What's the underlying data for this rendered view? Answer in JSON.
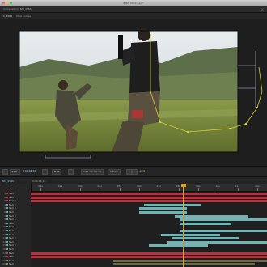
{
  "window": {
    "title": "BMW 5000.aep *",
    "lights": [
      "#ff5f56",
      "#ffbd2e",
      "#27c93f"
    ]
  },
  "composition_panel": {
    "title": "Composition: NM_4586",
    "close_glyph": "×",
    "tabs": [
      "1_4586",
      "Shot Comps"
    ]
  },
  "viewer": {
    "description_icon": "video-frame",
    "bezier_color": "#d8d030",
    "guide_color": "#bcd2e6"
  },
  "comp_toolbar": {
    "zoom": "50%",
    "timecode": "0;00;06;10",
    "resolution": "Half",
    "view": "Active Camera",
    "views": "1 View",
    "exposure": "+0.0"
  },
  "timeline": {
    "header_left": "NM_4586",
    "header_time": "0;00;06;10",
    "ticks": [
      "01s",
      "02s",
      "03s",
      "04s",
      "05s",
      "06s",
      "07s",
      "08s",
      "09s",
      "10s",
      "11s",
      "12s"
    ],
    "layers": [
      {
        "n": "1",
        "name": "Null",
        "color": "#c43d3d"
      },
      {
        "n": "2",
        "name": "Null",
        "color": "#c43d3d"
      },
      {
        "n": "3",
        "name": "Null 9",
        "color": "#c43d3d"
      },
      {
        "n": "4",
        "name": "Null 2",
        "color": "#5fa8a8"
      },
      {
        "n": "5",
        "name": "Null 3",
        "color": "#5fa8a8"
      },
      {
        "n": "6",
        "name": "Null",
        "color": "#5fa8a8"
      },
      {
        "n": "7",
        "name": "Null 4",
        "color": "#5fa8a8"
      },
      {
        "n": "8",
        "name": "Null 5",
        "color": "#5fa8a8"
      },
      {
        "n": "9",
        "name": "Null",
        "color": "#5fa8a8"
      },
      {
        "n": "10",
        "name": "Null 6",
        "color": "#5fa8a8"
      },
      {
        "n": "11",
        "name": "Null",
        "color": "#5fa8a8"
      },
      {
        "n": "12",
        "name": "Null 7",
        "color": "#5fa8a8"
      },
      {
        "n": "13",
        "name": "Null 8",
        "color": "#5fa8a8"
      },
      {
        "n": "14",
        "name": "Null",
        "color": "#5fa8a8"
      },
      {
        "n": "15",
        "name": "Null 9",
        "color": "#5fa8a8"
      },
      {
        "n": "16",
        "name": "Null",
        "color": "#5fa8a8"
      },
      {
        "n": "17",
        "name": "Null",
        "color": "#c43d3d"
      },
      {
        "n": "18",
        "name": "Null",
        "color": "#c43d3d"
      },
      {
        "n": "19",
        "name": "Null",
        "color": "#8a8a5a"
      },
      {
        "n": "20",
        "name": "Null",
        "color": "#8a8a5a"
      }
    ],
    "bars": [
      {
        "start": 0.0,
        "end": 1.0,
        "color": "#b8323e"
      },
      {
        "start": 0.0,
        "end": 1.0,
        "color": "#b8323e"
      },
      {
        "start": 0.0,
        "end": 1.0,
        "color": "#b8323e"
      },
      {
        "start": 0.48,
        "end": 0.72,
        "color": "#6fb4b4"
      },
      {
        "start": 0.46,
        "end": 0.66,
        "color": "#6fb4b4"
      },
      {
        "start": 0.46,
        "end": 0.66,
        "color": "#6fb4b4"
      },
      {
        "start": 0.61,
        "end": 0.92,
        "color": "#6fb4b4"
      },
      {
        "start": 0.63,
        "end": 1.0,
        "color": "#6fb4b4"
      },
      {
        "start": 0.63,
        "end": 0.85,
        "color": "#6fb4b4"
      },
      {
        "start": 0.0,
        "end": 0.0,
        "color": "#6fb4b4"
      },
      {
        "start": 0.63,
        "end": 1.0,
        "color": "#6fb4b4"
      },
      {
        "start": 0.55,
        "end": 0.8,
        "color": "#6fb4b4"
      },
      {
        "start": 0.6,
        "end": 0.88,
        "color": "#6fb4b4"
      },
      {
        "start": 0.58,
        "end": 1.0,
        "color": "#6fb4b4"
      },
      {
        "start": 0.5,
        "end": 0.75,
        "color": "#6fb4b4"
      },
      {
        "start": 0.0,
        "end": 0.0,
        "color": "#6fb4b4"
      },
      {
        "start": 0.0,
        "end": 1.0,
        "color": "#b8323e"
      },
      {
        "start": 0.0,
        "end": 1.0,
        "color": "#b8323e"
      },
      {
        "start": 0.35,
        "end": 1.0,
        "color": "#6a6a4a"
      },
      {
        "start": 0.35,
        "end": 0.95,
        "color": "#6a6a4a"
      }
    ],
    "playhead": 0.644,
    "playhead_color": "#e0a020"
  }
}
